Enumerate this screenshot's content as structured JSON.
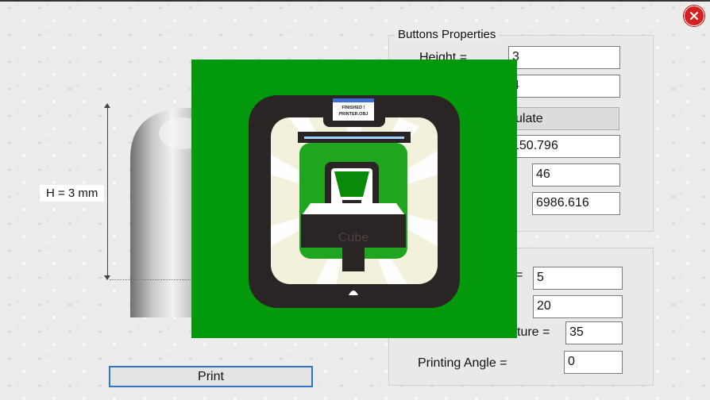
{
  "window": {
    "close_icon": "close-icon"
  },
  "preview": {
    "height_label": "H = 3    mm"
  },
  "buttons_properties": {
    "title": "Buttons Properties",
    "height_label": "Height    =",
    "height_value": "3",
    "field2_value": "4",
    "calculate_label": "ulate",
    "field3_value": "150.796",
    "field4_value": "46",
    "field5_value": "6986.616"
  },
  "printing": {
    "field1_label": "=",
    "field1_value": "5",
    "field2_value": "20",
    "temperature_label": "ture  =",
    "temperature_value": "35",
    "angle_label": "Printing Angle   =",
    "angle_value": "0"
  },
  "actions": {
    "print_label": "Print"
  },
  "splash": {
    "screen_line1": "FINISHED !",
    "screen_line2": "PRINTER.OBJ",
    "brand": "Cube",
    "bg_color": "#029a0c"
  }
}
